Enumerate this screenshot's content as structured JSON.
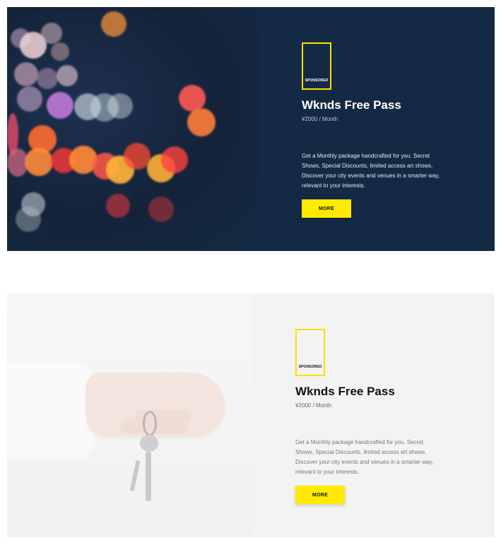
{
  "cards": [
    {
      "badge": "SPONSORED",
      "title": "Wknds Free Pass",
      "price": "¥2000 / Month",
      "description": "Get a Monthly package handcrafted for you. Secret Shows, Special Discounts, limited access art shows. Discover your city events and venues in a smarter way, relevant to your interests.",
      "button": "MORE",
      "image": "bokeh-city-lights-photo"
    },
    {
      "badge": "SPONSORED",
      "title": "Wknds Free Pass",
      "price": "¥2000 / Month",
      "description": "Get a Monthly package handcrafted for you. Secret Shows, Special Discounts, limited access art shows. Discover your city events and venues in a smarter way, relevant to your interests.",
      "button": "MORE",
      "image": "hand-holding-keys-photo"
    }
  ],
  "colors": {
    "dark_card_bg": "#142a44",
    "light_card_bg": "#f2f3f2",
    "accent_yellow": "#ffea00"
  }
}
